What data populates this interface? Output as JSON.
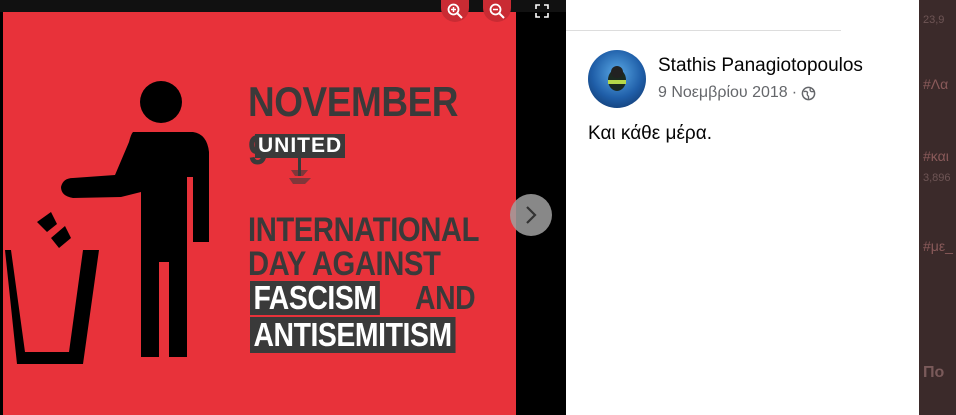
{
  "viewer": {
    "poster": {
      "headline": "NOVEMBER 9",
      "logo_text": "UNITED",
      "line1": "INTERNATIONAL",
      "line2": "DAY AGAINST",
      "line3a": "FASCISM",
      "line3b": "AND",
      "line4": "ANTISEMITISM",
      "background_color": "#e8323a",
      "text_color": "#3a3a3a"
    },
    "controls": {
      "zoom_in_icon": "zoom-in-icon",
      "zoom_out_icon": "zoom-out-icon",
      "fullscreen_icon": "expand-icon",
      "next_icon": "chevron-right-icon"
    }
  },
  "post": {
    "author": "Stathis Panagiotopoulos",
    "date": "9 Νοεμβρίου 2018",
    "separator": "·",
    "privacy_icon": "globe-icon",
    "text": "Και κάθε μέρα."
  },
  "right_sidebar": {
    "items": [
      "23,9",
      "#Λα",
      "#και",
      "3,896",
      "#με_",
      "Πο"
    ]
  }
}
